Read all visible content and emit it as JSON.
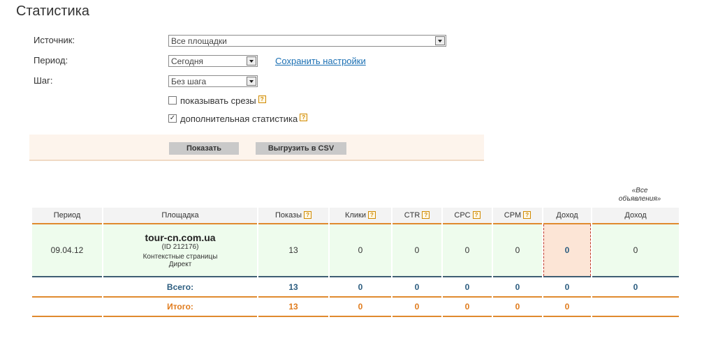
{
  "page": {
    "title": "Статистика"
  },
  "filters": {
    "source_label": "Источник:",
    "source_value": "Все площадки",
    "period_label": "Период:",
    "period_value": "Сегодня",
    "save_link": "Сохранить настройки",
    "step_label": "Шаг:",
    "step_value": "Без шага",
    "show_slices_label": "показывать срезы",
    "show_slices_checked": false,
    "extra_stats_label": "дополнительная статистика",
    "extra_stats_checked": true,
    "help_glyph": "?"
  },
  "buttons": {
    "show": "Показать",
    "export_csv": "Выгрузить в CSV"
  },
  "note": {
    "all_ads": "«Все объявления»"
  },
  "table": {
    "headers": [
      "Период",
      "Площадка",
      "Показы",
      "Клики",
      "CTR",
      "CPC",
      "CPM",
      "Доход",
      "Доход"
    ],
    "row": {
      "period": "09.04.12",
      "site": "tour-cn.com.ua",
      "site_id": "(ID 212176)",
      "site_type": "Контекстные страницы",
      "site_source": "Директ",
      "shows": "13",
      "clicks": "0",
      "ctr": "0",
      "cpc": "0",
      "cpm": "0",
      "income": "0",
      "income_all": "0"
    },
    "total": {
      "label": "Всего:",
      "shows": "13",
      "clicks": "0",
      "ctr": "0",
      "cpc": "0",
      "cpm": "0",
      "income": "0",
      "income_all": "0"
    },
    "grand_total": {
      "label": "Итого:",
      "shows": "13",
      "clicks": "0",
      "ctr": "0",
      "cpc": "0",
      "cpm": "0",
      "income": "0"
    }
  },
  "colors": {
    "accent_orange": "#e08a2e",
    "link_blue": "#1a6fb3",
    "total_blue": "#2b5c7f",
    "row_green": "#eefced"
  }
}
